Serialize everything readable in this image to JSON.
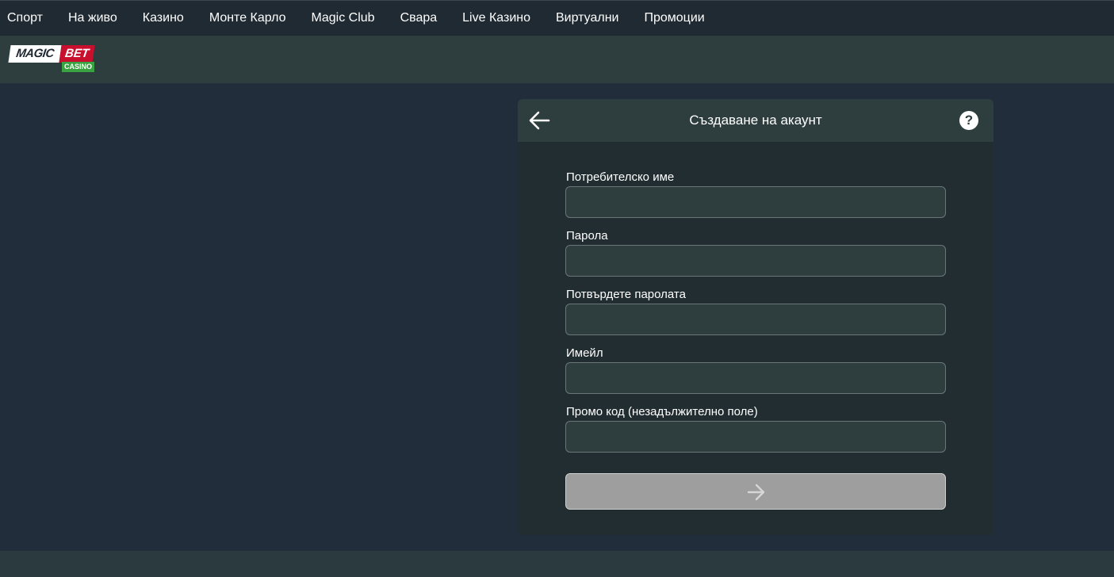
{
  "nav": {
    "items": [
      "Спорт",
      "На живо",
      "Казино",
      "Монте Карло",
      "Magic Club",
      "Свара",
      "Live Казино",
      "Виртуални",
      "Промоции"
    ]
  },
  "logo": {
    "magic": "MAGIC",
    "bet": "BET",
    "casino": "CASINO"
  },
  "form": {
    "title": "Създаване на акаунт",
    "help_symbol": "?",
    "back_icon": "arrow-left-icon",
    "submit_icon": "arrow-right-icon",
    "fields": [
      {
        "label": "Потребителско име",
        "value": "",
        "placeholder": ""
      },
      {
        "label": "Парола",
        "value": "",
        "placeholder": ""
      },
      {
        "label": "Потвърдете паролата",
        "value": "",
        "placeholder": ""
      },
      {
        "label": "Имейл",
        "value": "",
        "placeholder": ""
      },
      {
        "label": "Промо код (незадължително поле)",
        "value": "",
        "placeholder": ""
      }
    ]
  },
  "colors": {
    "page_bg": "#212d3b",
    "topnav_bg": "#1f2a33",
    "header_bg": "#2e3d3e",
    "panel_bg": "#222d32",
    "logo_red": "#c8102e",
    "logo_green": "#3aa341",
    "submit_disabled": "#9e9e9e"
  }
}
